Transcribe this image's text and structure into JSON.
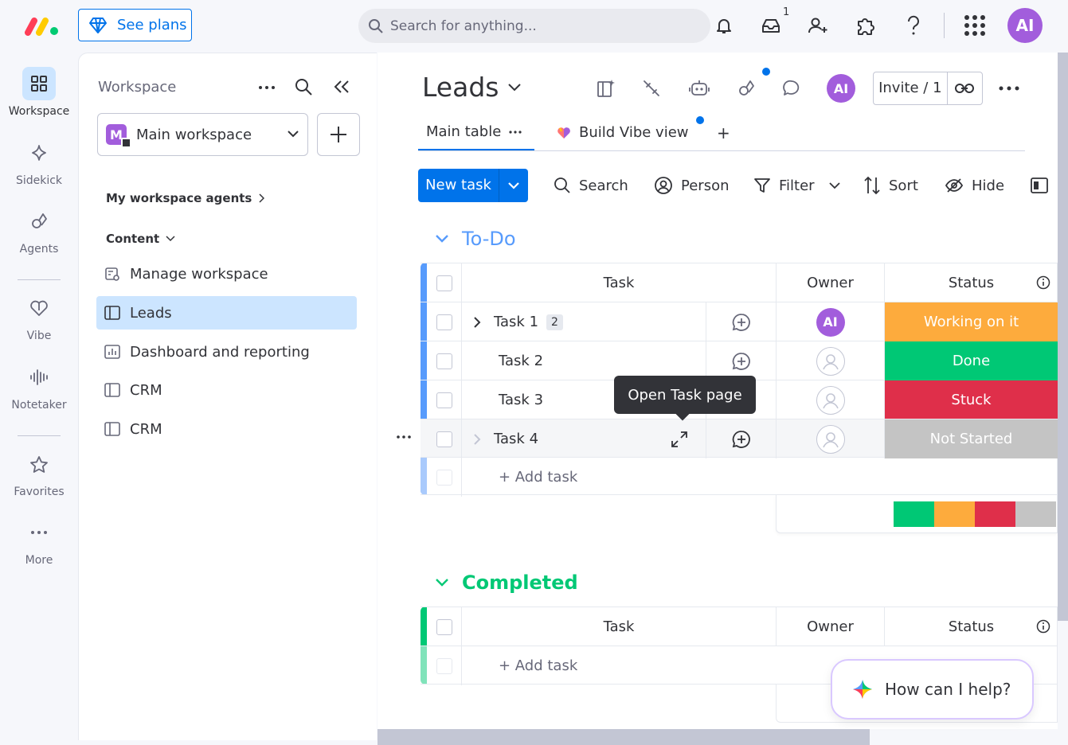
{
  "topbar": {
    "see_plans": "See plans",
    "search_placeholder": "Search for anything...",
    "inbox_count": "1",
    "user_initials": "AI"
  },
  "rail": {
    "items": [
      {
        "label": "Workspace",
        "icon": "grid-icon"
      },
      {
        "label": "Sidekick",
        "icon": "sparkle-icon"
      },
      {
        "label": "Agents",
        "icon": "agents-icon"
      },
      {
        "label": "Vibe",
        "icon": "heart-icon"
      },
      {
        "label": "Notetaker",
        "icon": "soundwave-icon"
      },
      {
        "label": "Favorites",
        "icon": "star-icon"
      },
      {
        "label": "More",
        "icon": "more-icon"
      }
    ]
  },
  "workspace_panel": {
    "title": "Workspace",
    "workspace_letter": "M",
    "workspace_name": "Main workspace",
    "agents_section": "My workspace agents",
    "content_section": "Content",
    "items": [
      {
        "label": "Manage workspace",
        "icon": "manage-workspace-icon"
      },
      {
        "label": "Leads",
        "icon": "board-icon"
      },
      {
        "label": "Dashboard and reporting",
        "icon": "dashboard-icon"
      },
      {
        "label": "CRM",
        "icon": "board-icon"
      },
      {
        "label": "CRM",
        "icon": "board-icon"
      }
    ]
  },
  "board": {
    "title": "Leads",
    "user_initials": "AI",
    "invite_label": "Invite / 1",
    "tabs": {
      "main_table": "Main table",
      "build_vibe": "Build Vibe view",
      "add": "+"
    },
    "toolbar": {
      "new_task": "New task",
      "search": "Search",
      "person": "Person",
      "filter": "Filter",
      "sort": "Sort",
      "hide": "Hide"
    }
  },
  "groups": [
    {
      "title": "To-Do",
      "color": "#579bfc",
      "columns": {
        "task": "Task",
        "owner": "Owner",
        "status": "Status"
      },
      "rows": [
        {
          "task": "Task 1",
          "subitems": "2",
          "owner": "AI",
          "status": "Working on it",
          "status_color": "#fdab3d"
        },
        {
          "task": "Task 2",
          "owner": "",
          "status": "Done",
          "status_color": "#00c875"
        },
        {
          "task": "Task 3",
          "owner": "",
          "status": "Stuck",
          "status_color": "#df2f4a"
        },
        {
          "task": "Task 4",
          "owner": "",
          "status": "Not Started",
          "status_color": "#c4c4c4"
        }
      ],
      "add_task": "+ Add task",
      "summary": [
        {
          "color": "#00c875",
          "share": 0.25
        },
        {
          "color": "#fdab3d",
          "share": 0.25
        },
        {
          "color": "#df2f4a",
          "share": 0.25
        },
        {
          "color": "#c4c4c4",
          "share": 0.25
        }
      ]
    },
    {
      "title": "Completed",
      "color": "#00c875",
      "columns": {
        "task": "Task",
        "owner": "Owner",
        "status": "Status"
      },
      "add_task": "+ Add task"
    }
  ],
  "tooltip": "Open Task page",
  "help_bubble": "How can I help?"
}
